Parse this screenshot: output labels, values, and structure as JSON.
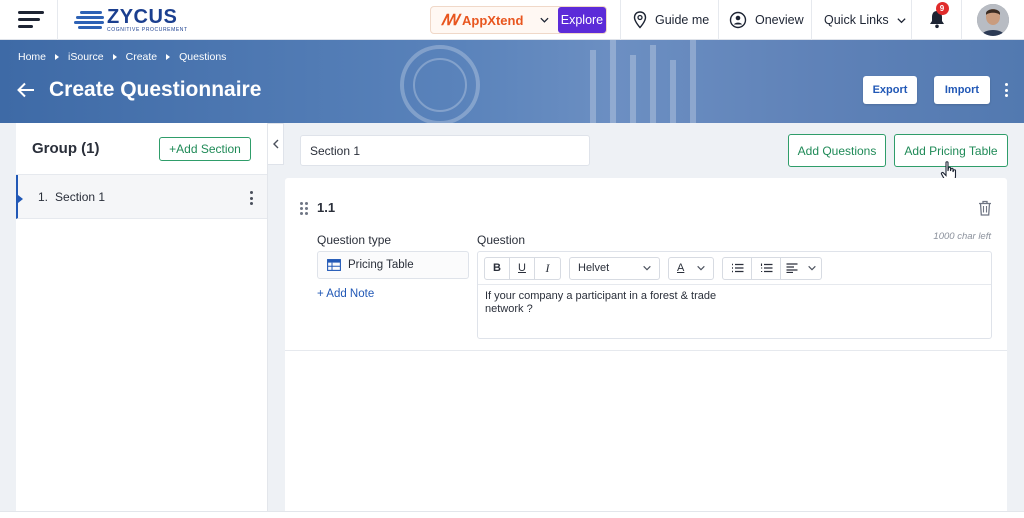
{
  "topbar": {
    "logo_name": "ZYCUS",
    "logo_tagline": "COGNITIVE PROCUREMENT",
    "appxtend_label": "AppXtend",
    "explore_label": "Explore",
    "guide_label": "Guide me",
    "oneview_label": "Oneview",
    "quicklinks_label": "Quick Links",
    "notification_count": "9"
  },
  "breadcrumb": [
    "Home",
    "iSource",
    "Create",
    "Questions"
  ],
  "page": {
    "title": "Create Questionnaire",
    "export_label": "Export",
    "import_label": "Import"
  },
  "sidebar": {
    "title": "Group (1)",
    "add_section_label": "+Add Section",
    "items": [
      {
        "number": "1.",
        "label": "Section 1"
      }
    ]
  },
  "main": {
    "section_name": "Section 1",
    "add_questions_label": "Add Questions",
    "add_pricing_table_label": "Add Pricing Table",
    "question": {
      "number": "1.1",
      "type_label": "Question type",
      "type_value": "Pricing Table",
      "add_note_label": "+ Add Note",
      "question_label": "Question",
      "char_left": "1000 char left",
      "font_value": "Helvet",
      "bold": "B",
      "underline": "U",
      "italic": "I",
      "text_color": "A",
      "text": "If your company a participant in a forest & trade network ?"
    }
  },
  "colors": {
    "accent_blue": "#2158b6",
    "accent_green": "#1f8a57",
    "explore_purple": "#5c2bd8",
    "appxtend_orange": "#e8561f",
    "badge_red": "#e02b2b"
  }
}
